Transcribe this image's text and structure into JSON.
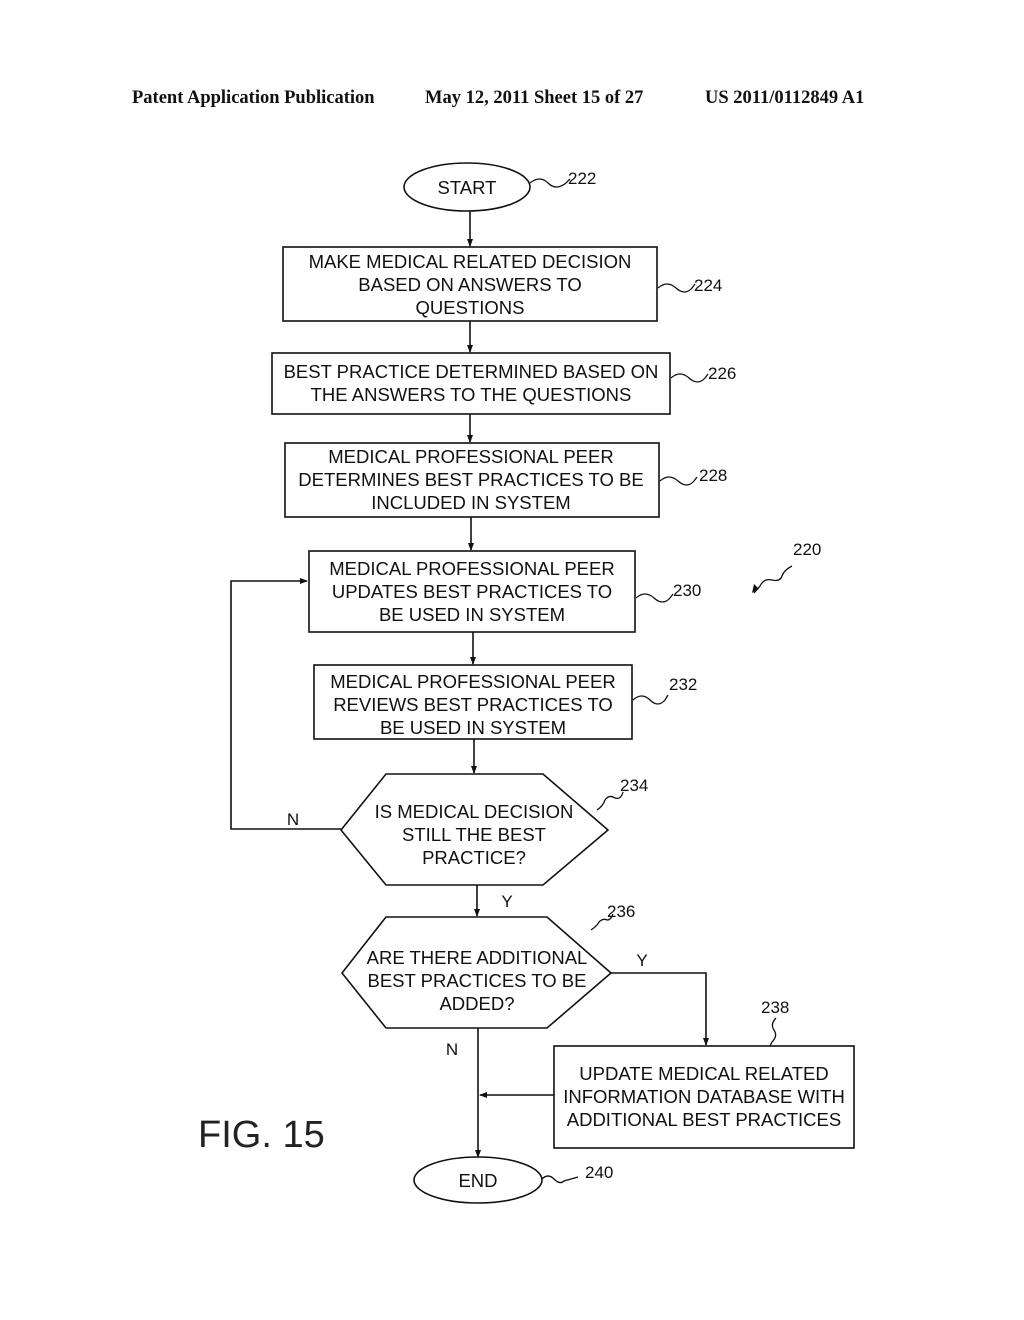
{
  "header": {
    "publication": "Patent Application Publication",
    "date_sheet": "May 12, 2011  Sheet 15 of 27",
    "number": "US 2011/0112849 A1"
  },
  "figure": {
    "label": "FIG. 15",
    "ref": "220"
  },
  "nodes": {
    "start": {
      "ref": "222",
      "lines": [
        "START"
      ]
    },
    "n224": {
      "ref": "224",
      "lines": [
        "MAKE MEDICAL RELATED DECISION",
        "BASED ON ANSWERS TO",
        "QUESTIONS"
      ]
    },
    "n226": {
      "ref": "226",
      "lines": [
        "BEST PRACTICE DETERMINED BASED ON",
        "THE ANSWERS TO THE QUESTIONS"
      ]
    },
    "n228": {
      "ref": "228",
      "lines": [
        "MEDICAL PROFESSIONAL PEER",
        "DETERMINES BEST PRACTICES TO BE",
        "INCLUDED IN SYSTEM"
      ]
    },
    "n230": {
      "ref": "230",
      "lines": [
        "MEDICAL PROFESSIONAL PEER",
        "UPDATES BEST PRACTICES TO",
        "BE USED IN SYSTEM"
      ]
    },
    "n232": {
      "ref": "232",
      "lines": [
        "MEDICAL PROFESSIONAL PEER",
        "REVIEWS BEST PRACTICES TO",
        "BE USED IN SYSTEM"
      ]
    },
    "n234": {
      "ref": "234",
      "lines": [
        "IS MEDICAL DECISION",
        "STILL THE BEST",
        "PRACTICE?"
      ]
    },
    "n236": {
      "ref": "236",
      "lines": [
        "ARE THERE ADDITIONAL",
        "BEST PRACTICES TO BE",
        "ADDED?"
      ]
    },
    "n238": {
      "ref": "238",
      "lines": [
        "UPDATE MEDICAL RELATED",
        "INFORMATION DATABASE WITH",
        "ADDITIONAL BEST PRACTICES"
      ]
    },
    "end": {
      "ref": "240",
      "lines": [
        "END"
      ]
    }
  },
  "edge_labels": {
    "n234_no": "N",
    "n234_yes": "Y",
    "n236_yes": "Y",
    "n236_no": "N"
  }
}
